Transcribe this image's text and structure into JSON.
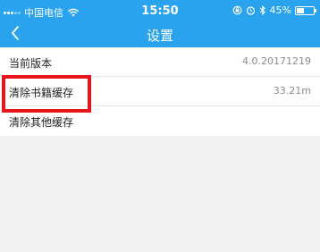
{
  "status_bar": {
    "carrier": "中国电信",
    "time": "15:50",
    "battery_text": "45%",
    "battery_level": 0.45,
    "icons": [
      "signal-icon",
      "wifi-icon",
      "lock-rotation-icon",
      "alarm-icon",
      "bluetooth-icon",
      "battery-icon"
    ]
  },
  "nav": {
    "title": "设置",
    "back_icon": "chevron-left-icon"
  },
  "settings": {
    "items": [
      {
        "label": "当前版本",
        "value": "4.0.20171219"
      },
      {
        "label": "清除书籍缓存",
        "value": "33.21m"
      },
      {
        "label": "清除其他缓存",
        "value": ""
      }
    ]
  },
  "colors": {
    "header": "#2aa3ee",
    "highlight": "#e8141c",
    "background": "#f2f2f2"
  }
}
